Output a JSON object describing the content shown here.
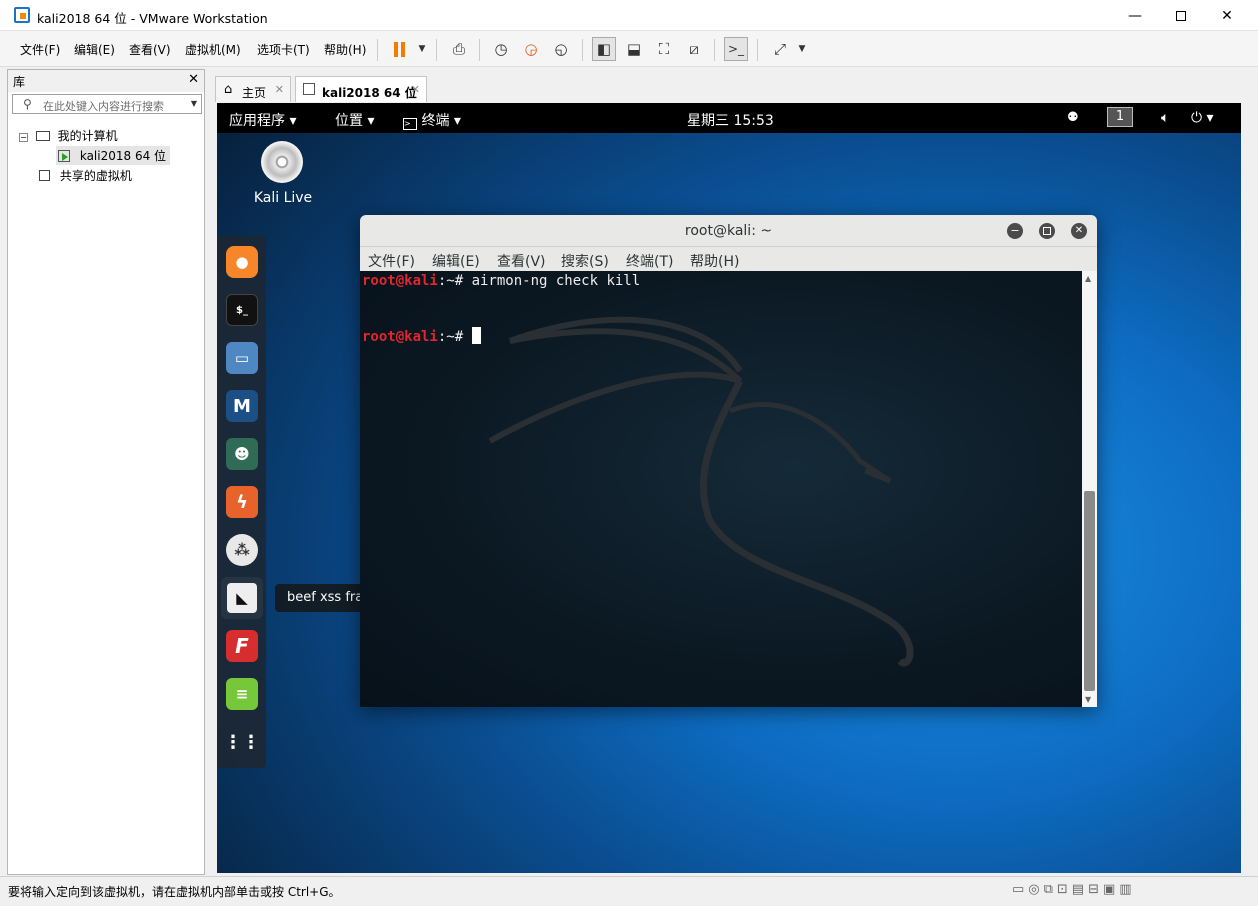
{
  "window": {
    "title": "kali2018 64 位 - VMware Workstation"
  },
  "menu": {
    "items": [
      "文件(F)",
      "编辑(E)",
      "查看(V)",
      "虚拟机(M)",
      "选项卡(T)",
      "帮助(H)"
    ]
  },
  "library": {
    "title": "库",
    "search_placeholder": "在此处键入内容进行搜索",
    "tree": {
      "my_computer": "我的计算机",
      "vm": "kali2018 64 位",
      "shared": "共享的虚拟机"
    }
  },
  "tabs": [
    {
      "label": "主页"
    },
    {
      "label": "kali2018 64 位"
    }
  ],
  "guest": {
    "topbar": {
      "apps": "应用程序",
      "places": "位置",
      "terminal": "终端",
      "clock": "星期三 15:53",
      "workspace": "1"
    },
    "desktop_icon": "Kali Live",
    "tooltip": "beef xss framework",
    "terminal": {
      "title": "root@kali: ~",
      "menu": [
        "文件(F)",
        "编辑(E)",
        "查看(V)",
        "搜索(S)",
        "终端(T)",
        "帮助(H)"
      ],
      "lines": [
        {
          "prompt_user": "root@kali",
          "prompt_rest": ":~# ",
          "command": "airmon-ng check kill"
        },
        {
          "prompt_user": "root@kali",
          "prompt_rest": ":~# ",
          "command": ""
        }
      ]
    }
  },
  "status": {
    "text": "要将输入定向到该虚拟机，请在虚拟机内部单击或按 Ctrl+G。"
  }
}
